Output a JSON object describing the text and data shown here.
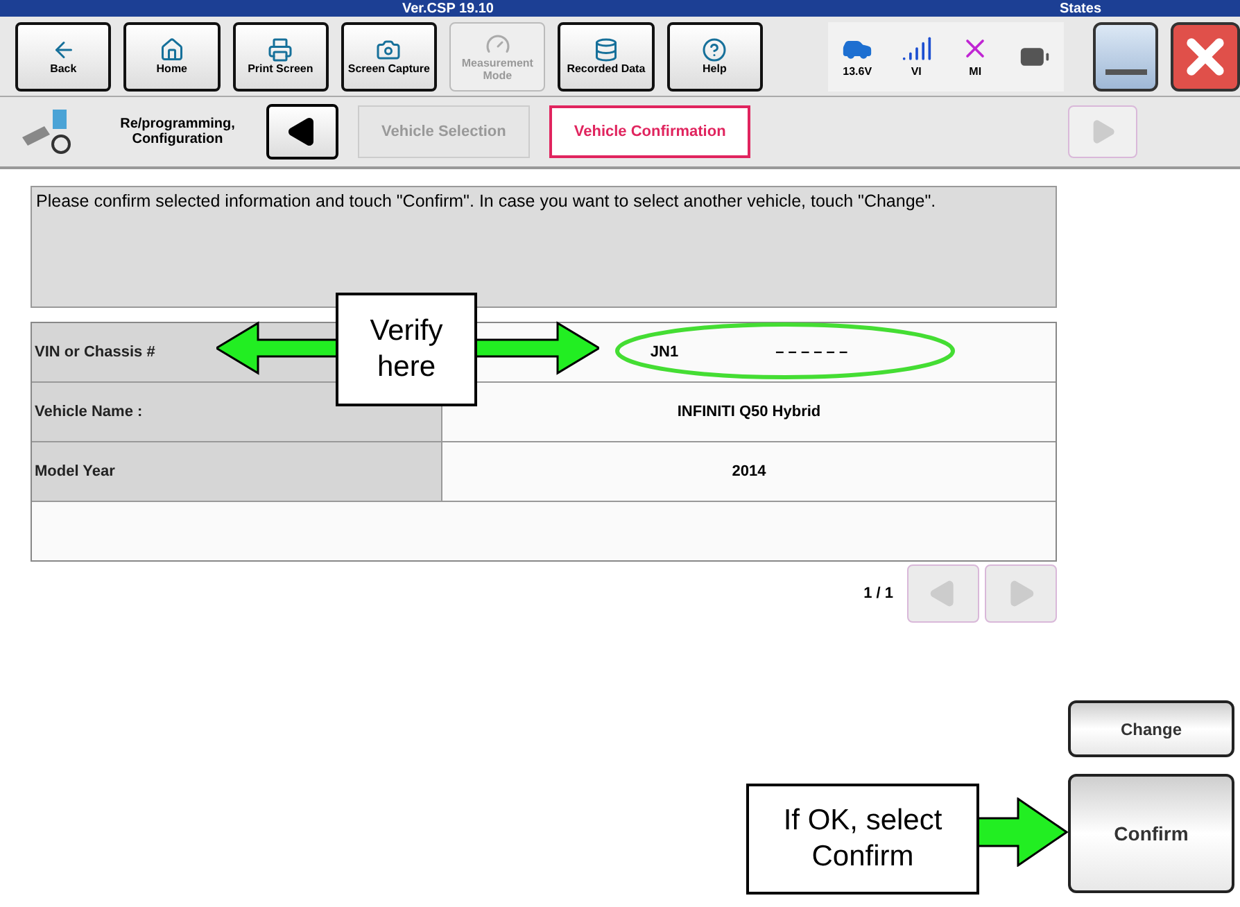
{
  "window": {
    "version": "Ver.CSP 19.10",
    "status": "States"
  },
  "toolbar": [
    {
      "label": "Back",
      "disabled": false
    },
    {
      "label": "Home",
      "disabled": false
    },
    {
      "label": "Print Screen",
      "disabled": false
    },
    {
      "label": "Screen Capture",
      "disabled": false
    },
    {
      "label": "Measurement Mode",
      "disabled": true
    },
    {
      "label": "Recorded Data",
      "disabled": false
    },
    {
      "label": "Help",
      "disabled": false
    }
  ],
  "status_indicators": [
    {
      "kind": "car",
      "label": "13.6V"
    },
    {
      "kind": "signal",
      "label": "VI"
    },
    {
      "kind": "cross",
      "label": "MI"
    },
    {
      "kind": "battery"
    }
  ],
  "breadcrumb": {
    "title": "Re/programming, Configuration",
    "steps": [
      {
        "label": "Vehicle Selection",
        "selected": false
      },
      {
        "label": "Vehicle Confirmation",
        "selected": true
      }
    ],
    "next_disabled": true
  },
  "message": "Please confirm selected information and touch \"Confirm\". In case you want to select another vehicle, touch \"Change\".",
  "table": {
    "rows": [
      {
        "label": "VIN or Chassis #",
        "value": "JN1",
        "masked": "– – – – – –"
      },
      {
        "label": "Vehicle Name :",
        "value": "INFINITI Q50 Hybrid"
      },
      {
        "label": "Model Year",
        "value": "2014"
      }
    ]
  },
  "pager": {
    "text": "1 / 1",
    "prev_disabled": true,
    "next_disabled": true
  },
  "buttons": [
    {
      "label": "Change",
      "kind": "small"
    },
    {
      "label": "Confirm",
      "kind": "large"
    }
  ],
  "annotations": [
    {
      "kind": "double",
      "text": "Verify here"
    },
    {
      "kind": "right",
      "text": "If OK, select Confirm"
    }
  ]
}
